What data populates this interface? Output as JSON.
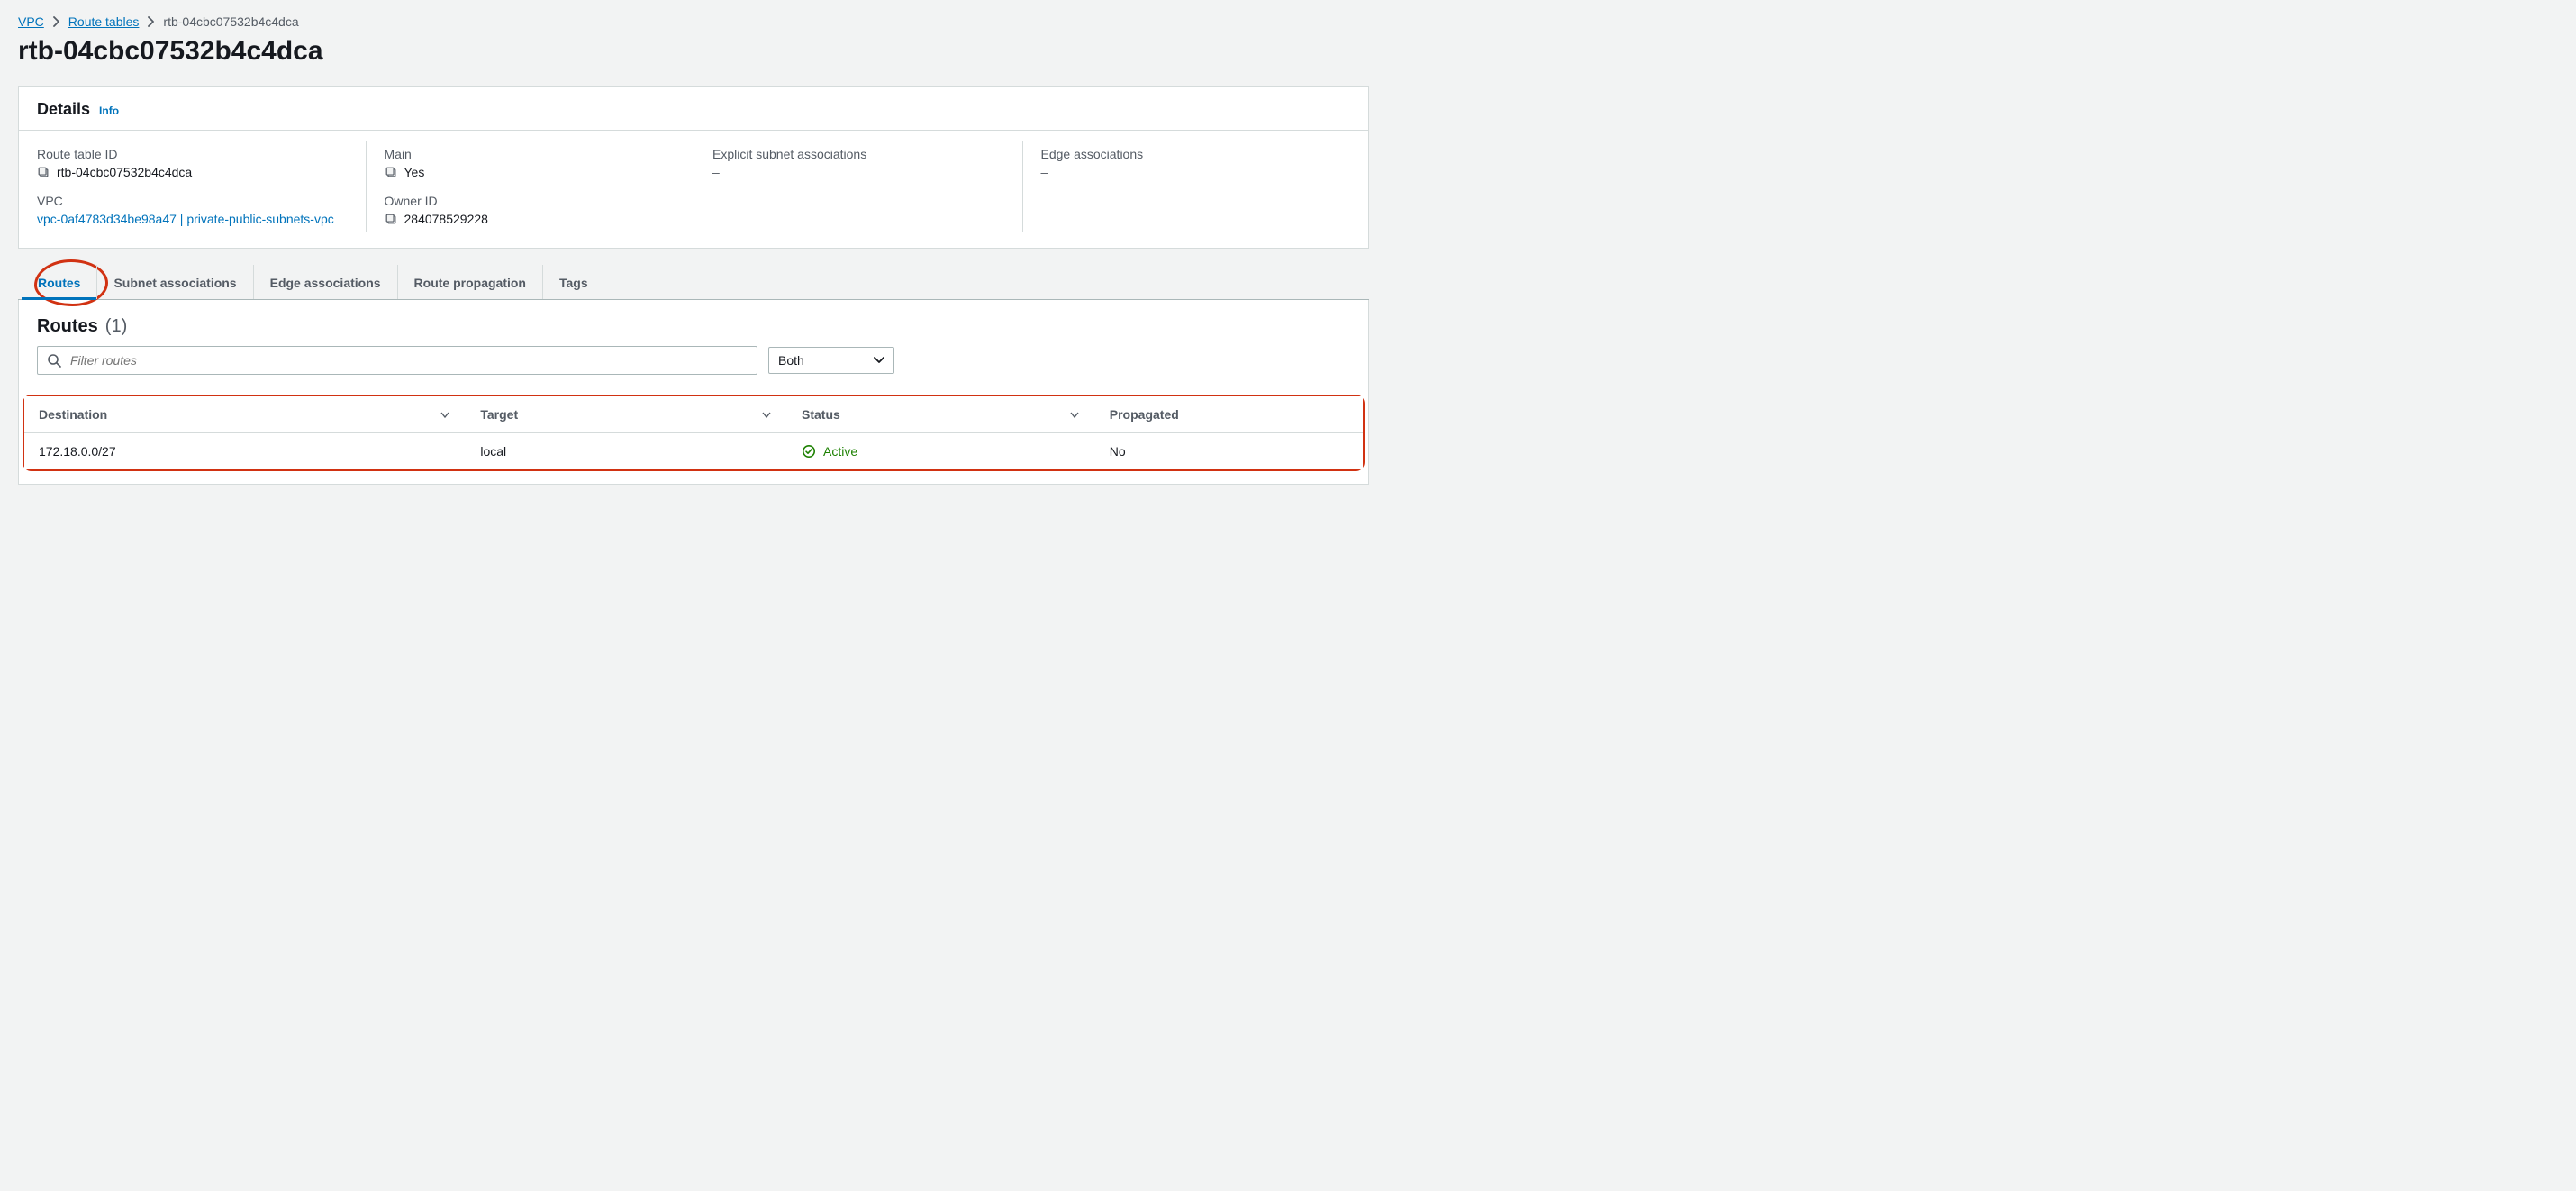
{
  "breadcrumb": {
    "items": [
      {
        "label": "VPC",
        "href": "#"
      },
      {
        "label": "Route tables",
        "href": "#"
      }
    ],
    "current": "rtb-04cbc07532b4c4dca"
  },
  "page_title": "rtb-04cbc07532b4c4dca",
  "details_panel": {
    "title": "Details",
    "info_label": "Info",
    "fields": {
      "route_table_id": {
        "label": "Route table ID",
        "value": "rtb-04cbc07532b4c4dca"
      },
      "vpc": {
        "label": "VPC",
        "value": "vpc-0af4783d34be98a47 | private-public-subnets-vpc"
      },
      "main": {
        "label": "Main",
        "value": "Yes"
      },
      "owner_id": {
        "label": "Owner ID",
        "value": "284078529228"
      },
      "explicit_subnet": {
        "label": "Explicit subnet associations",
        "value": "–"
      },
      "edge": {
        "label": "Edge associations",
        "value": "–"
      }
    }
  },
  "tabs": [
    {
      "id": "routes",
      "label": "Routes",
      "active": true
    },
    {
      "id": "subnet",
      "label": "Subnet associations",
      "active": false
    },
    {
      "id": "edge",
      "label": "Edge associations",
      "active": false
    },
    {
      "id": "routeprop",
      "label": "Route propagation",
      "active": false
    },
    {
      "id": "tags",
      "label": "Tags",
      "active": false
    }
  ],
  "routes_section": {
    "title": "Routes",
    "count_display": "(1)",
    "filter_placeholder": "Filter routes",
    "propagation_filter": {
      "selected": "Both"
    },
    "columns": {
      "destination": "Destination",
      "target": "Target",
      "status": "Status",
      "propagated": "Propagated"
    },
    "rows": [
      {
        "destination": "172.18.0.0/27",
        "target": "local",
        "status": "Active",
        "propagated": "No"
      }
    ]
  }
}
